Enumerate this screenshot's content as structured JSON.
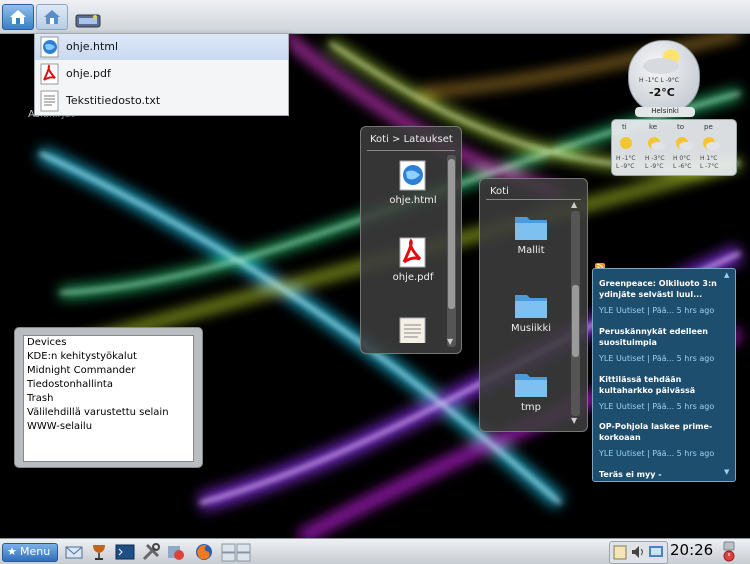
{
  "dropdown": {
    "items": [
      {
        "label": "ohje.html",
        "icon": "html-file-icon"
      },
      {
        "label": "ohje.pdf",
        "icon": "pdf-file-icon"
      },
      {
        "label": "Tekstitiedosto.txt",
        "icon": "text-file-icon"
      }
    ]
  },
  "desktop": {
    "obscured_icon_label": "Asiakirjat"
  },
  "folder_downloads": {
    "title": "Koti > Lataukset",
    "files": [
      {
        "label": "ohje.html",
        "icon": "html-file-icon"
      },
      {
        "label": "ohje.pdf",
        "icon": "pdf-file-icon"
      },
      {
        "label": "",
        "icon": "text-file-icon"
      }
    ]
  },
  "folder_home": {
    "title": "Koti",
    "files": [
      {
        "label": "Mallit",
        "icon": "folder-icon"
      },
      {
        "label": "Musiikki",
        "icon": "folder-icon"
      },
      {
        "label": "tmp",
        "icon": "folder-icon"
      }
    ]
  },
  "devices": {
    "items": [
      "Devices",
      "KDE:n kehitystyökalut",
      "Midnight Commander",
      "Tiedostonhallinta",
      "Trash",
      "Välilehdillä varustettu selain",
      "WWW-selailu"
    ]
  },
  "news": {
    "items": [
      {
        "headline": "Greenpeace: Olkiluoto 3:n ydinjäte selvästi luul...",
        "source": "YLE Uutiset | Pää... 5 hrs ago"
      },
      {
        "headline": "Peruskännykät edelleen suosituimpia",
        "source": "YLE Uutiset | Pää... 5 hrs ago"
      },
      {
        "headline": "Kittilässä tehdään kultaharkko päivässä",
        "source": "YLE Uutiset | Pää... 5 hrs ago"
      },
      {
        "headline": "OP-Pohjola laskee prime-korkoaan",
        "source": "YLE Uutiset | Pää... 5 hrs ago"
      },
      {
        "headline": "Teräs ei myy -",
        "source": ""
      }
    ]
  },
  "weather": {
    "temp": "-2°C",
    "current_hi": "H -1°C",
    "current_lo": "L -9°C",
    "city": "Helsinki",
    "days": [
      {
        "day": "ti",
        "hi": "H -1°C",
        "lo": "L -9°C"
      },
      {
        "day": "ke",
        "hi": "H -3°C",
        "lo": "L -9°C"
      },
      {
        "day": "to",
        "hi": "H 0°C",
        "lo": "L -6°C"
      },
      {
        "day": "pe",
        "hi": "H 1°C",
        "lo": "L -7°C"
      }
    ]
  },
  "panel": {
    "menu_label": "Menu",
    "clock": "20:26"
  },
  "colors": {
    "accent": "#3a7fc6",
    "news_bg": "#1d4e6e",
    "news_link": "#9ad0f5"
  }
}
